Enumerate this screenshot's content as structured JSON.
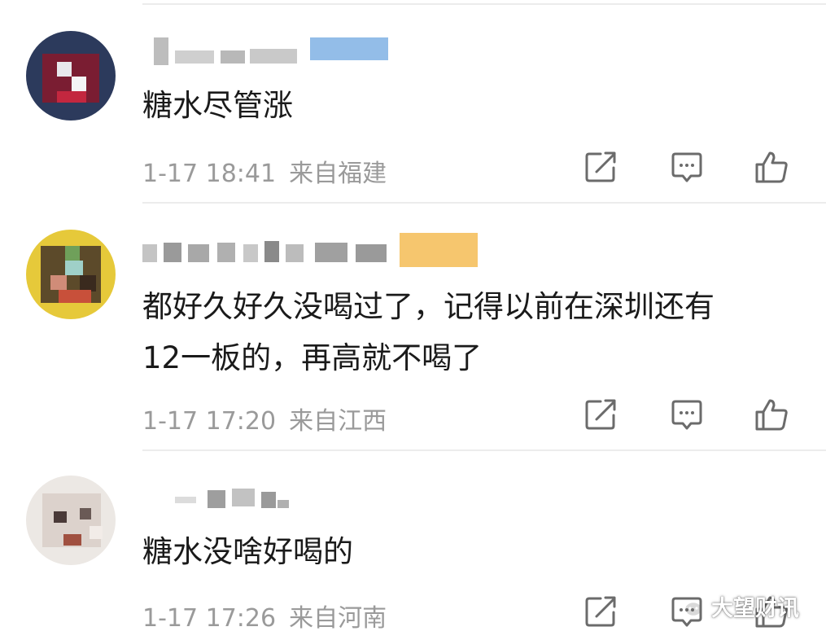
{
  "comments": [
    {
      "text": "糖水尽管涨",
      "time": "1-17 18:41",
      "location": "来自福建"
    },
    {
      "text_line1": "都好久好久没喝过了，记得以前在深圳还有",
      "text_line2": "12一板的，再高就不喝了",
      "time": "1-17 17:20",
      "location": "来自江西"
    },
    {
      "text": "糖水没啥好喝的",
      "time": "1-17 17:26",
      "location": "来自河南"
    }
  ],
  "icons": {
    "share": "share-icon",
    "reply": "comment-icon",
    "like": "thumbs-up-icon"
  },
  "watermark": {
    "text": "大望财讯"
  },
  "colors": {
    "text": "#1a1a1a",
    "meta": "#9a9a9a",
    "icon": "#6b6b6b",
    "divider": "#ececec"
  }
}
